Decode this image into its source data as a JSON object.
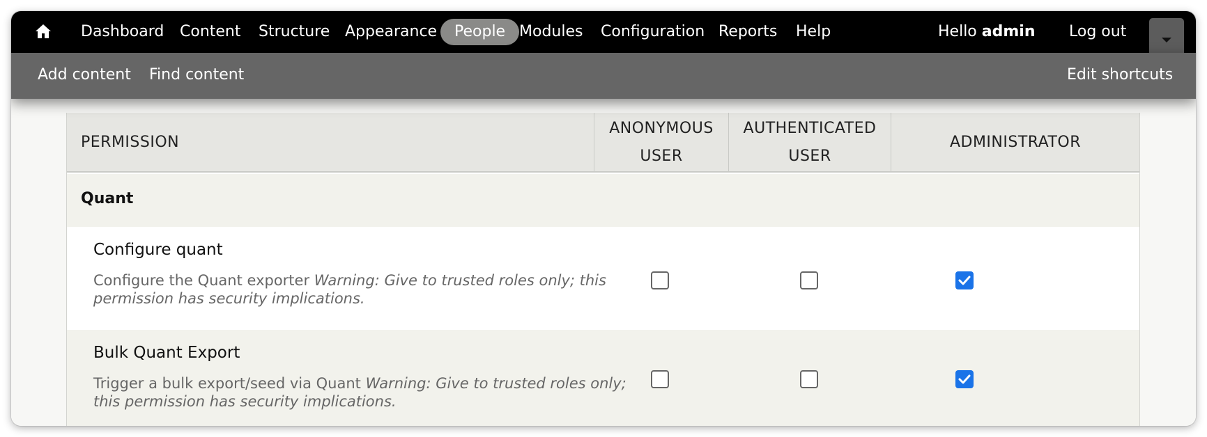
{
  "toolbar": {
    "home_icon": "home-icon",
    "nav": [
      {
        "label": "Dashboard"
      },
      {
        "label": "Content"
      },
      {
        "label": "Structure"
      },
      {
        "label": "Appearance"
      },
      {
        "label": "People",
        "active": true
      },
      {
        "label": "Modules"
      },
      {
        "label": "Configuration"
      },
      {
        "label": "Reports"
      },
      {
        "label": "Help"
      }
    ],
    "hello_prefix": "Hello",
    "username": "admin",
    "logout": "Log out",
    "tray_toggle_icon": "caret-down-icon"
  },
  "shortcuts": {
    "add_content": "Add content",
    "find_content": "Find content",
    "edit_shortcuts": "Edit shortcuts"
  },
  "table": {
    "headers": {
      "permission": "PERMISSION",
      "anonymous_line1": "ANONYMOUS",
      "anonymous_line2": "USER",
      "authenticated_line1": "AUTHENTICATED",
      "authenticated_line2": "USER",
      "administrator": "ADMINISTRATOR"
    },
    "module": "Quant",
    "permissions": [
      {
        "title": "Configure quant",
        "description": "Configure the Quant exporter",
        "warning": "Warning: Give to trusted roles only; this permission has security implications.",
        "anonymous": false,
        "authenticated": false,
        "administrator": true
      },
      {
        "title": "Bulk Quant Export",
        "description": "Trigger a bulk export/seed via Quant",
        "warning": "Warning: Give to trusted roles only; this permission has security implications.",
        "anonymous": false,
        "authenticated": false,
        "administrator": true
      }
    ]
  },
  "colors": {
    "toolbar_bg": "#000000",
    "tray_bg": "#666666",
    "active_pill": "#8a8a88",
    "checkbox_checked": "#1a73e8",
    "header_bg": "#e6e6e2",
    "alt_row_bg": "#f2f2ec"
  }
}
